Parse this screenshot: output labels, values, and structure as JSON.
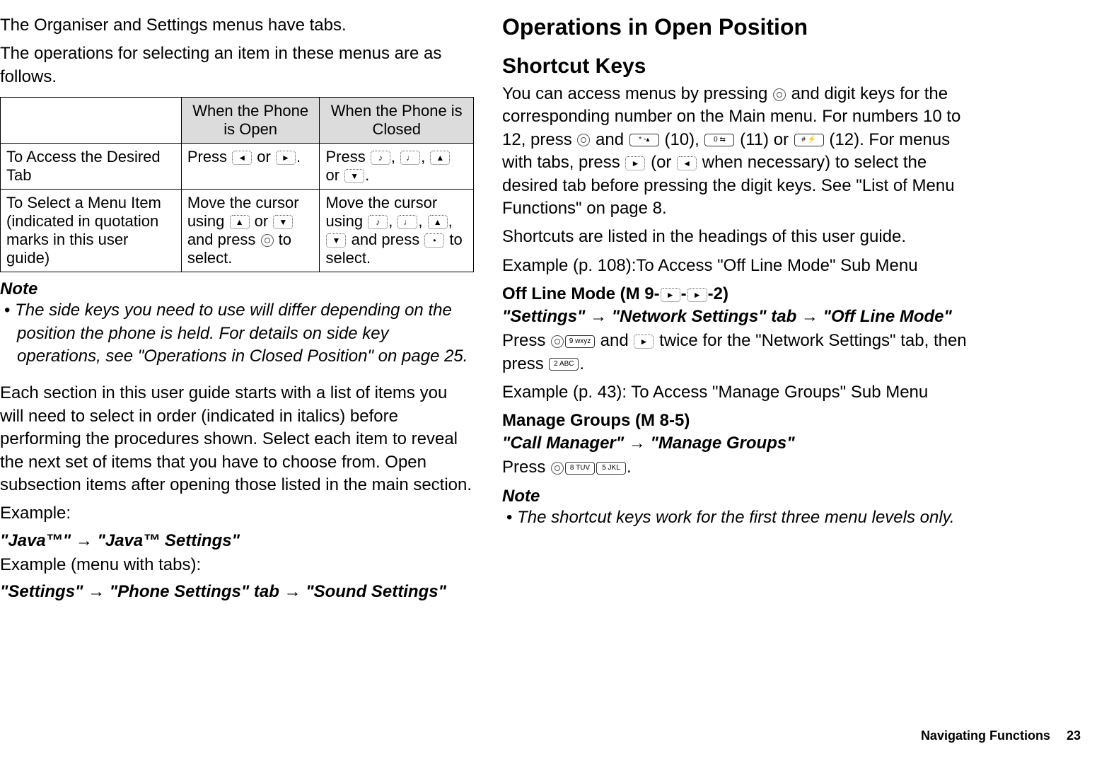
{
  "left": {
    "intro1": "The Organiser and Settings menus have tabs.",
    "intro2": "The operations for selecting an item in these menus are as follows.",
    "table": {
      "head_open": "When the Phone is Open",
      "head_closed": "When the Phone is Closed",
      "row1_label": "To Access the Desired Tab",
      "row1_open_a": "Press ",
      "row1_open_b": " or ",
      "row1_open_c": ".",
      "row1_closed_a": "Press ",
      "row1_closed_b": ", ",
      "row1_closed_c": ", ",
      "row1_closed_d": " or ",
      "row1_closed_e": ".",
      "row2_label": "To Select a Menu Item (indicated in quotation marks in this user guide)",
      "row2_open_a": "Move the cursor using ",
      "row2_open_b": " or ",
      "row2_open_c": " and press ",
      "row2_open_d": " to select.",
      "row2_closed_a": "Move the cursor using ",
      "row2_closed_b": ", ",
      "row2_closed_c": ", ",
      "row2_closed_d": ", ",
      "row2_closed_e": " and press ",
      "row2_closed_f": " to select."
    },
    "note_heading": "Note",
    "note_body": "The side keys you need to use will differ depending on the position the phone is held. For details on side key operations, see \"Operations in Closed Position\" on page 25.",
    "para2": "Each section in this user guide starts with a list of items you will need to select in order (indicated in italics) before performing the procedures shown. Select each item to reveal the next set of items that you have to choose from. Open subsection items after opening those listed in the main section.",
    "example_label": "Example:",
    "example1": "\"Java™\" → \"Java™ Settings\"",
    "example_tabs_label": "Example (menu with tabs):",
    "example2": "\"Settings\" → \"Phone Settings\" tab → \"Sound Settings\""
  },
  "right": {
    "h1": "Operations in Open Position",
    "h2": "Shortcut Keys",
    "para1_a": "You can access menus by pressing ",
    "para1_b": " and digit keys for the corresponding number on the Main menu. For numbers 10 to 12, press ",
    "para1_c": " and ",
    "para1_d": " (10), ",
    "para1_e": " (11) or ",
    "para1_f": " (12). For menus with tabs, press ",
    "para1_g": " (or ",
    "para1_h": " when necessary) to select the desired tab before pressing the digit keys. See \"List of Menu Functions\" on page 8.",
    "para2": "Shortcuts are listed in the headings of this user guide.",
    "example_p108": "Example (p. 108):To Access \"Off Line Mode\" Sub Menu",
    "offline_heading_a": "Off Line Mode (M 9-",
    "offline_heading_b": "-",
    "offline_heading_c": "-2)",
    "offline_path": "\"Settings\" → \"Network Settings\" tab → \"Off Line Mode\"",
    "offline_instr_a": "Press ",
    "offline_instr_b": " and ",
    "offline_instr_c": " twice for the \"Network Settings\" tab, then press ",
    "offline_instr_d": ".",
    "example_p43": "Example (p. 43):  To Access \"Manage Groups\" Sub Menu",
    "mg_heading": "Manage Groups (M 8-5)",
    "mg_path": "\"Call Manager\" → \"Manage Groups\"",
    "mg_instr_a": "Press ",
    "mg_instr_b": ".",
    "note_heading": "Note",
    "note_body": "The shortcut keys work for the first three menu levels only."
  },
  "footer": {
    "title": "Navigating Functions",
    "page": "23"
  },
  "keylabels": {
    "left": "◄",
    "right": "►",
    "up": "▲",
    "down": "▼",
    "side1": "♪",
    "side2": "♩",
    "dot": "•",
    "star": "* ◦▴",
    "zero": "0 ⇆",
    "hash": "# ⚡",
    "nine": "9 wxyz",
    "two": "2 ABC",
    "eight": "8 TUV",
    "five": "5 JKL"
  }
}
